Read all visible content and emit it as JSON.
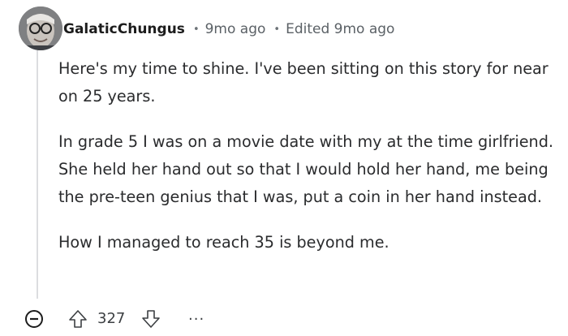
{
  "comment": {
    "author": "GalaticChungus",
    "separator": "•",
    "time": "9mo ago",
    "edited": "Edited 9mo ago",
    "paragraphs": [
      "Here's my time to shine. I've been sitting on this story for near on 25 years.",
      "In grade 5 I was on a movie date with my at the time girlfriend. She held her hand out so that I would hold her hand, me being the pre-teen genius that I was, put a coin in her hand instead.",
      "How I managed to reach 35 is beyond me."
    ]
  },
  "actions": {
    "score": "327",
    "more_label": "...",
    "icons": {
      "collapse": "collapse-minus-icon",
      "upvote": "upvote-arrow-icon",
      "downvote": "downvote-arrow-icon"
    }
  },
  "colors": {
    "text": "#1c1c1c",
    "meta": "#5b6166",
    "thread_line": "#dcdde0",
    "icon": "#3c3f42"
  }
}
